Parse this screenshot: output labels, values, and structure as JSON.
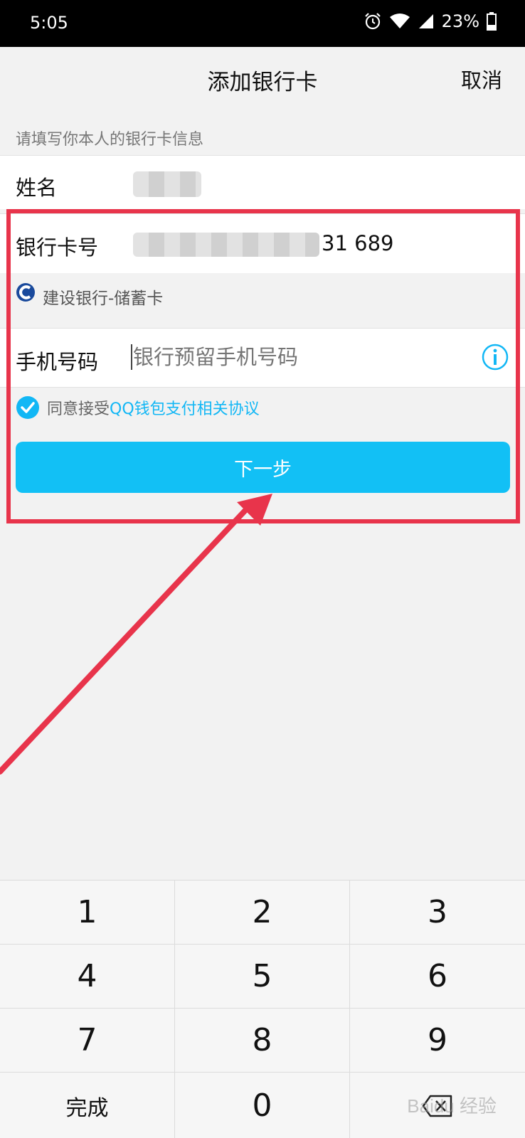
{
  "status": {
    "time": "5:05",
    "battery": "23%"
  },
  "nav": {
    "title": "添加银行卡",
    "cancel": "取消"
  },
  "hint": "请填写你本人的银行卡信息",
  "form": {
    "name_label": "姓名",
    "card_label": "银行卡号",
    "card_visible_suffix": "31 689",
    "bank_name": "建设银行-储蓄卡",
    "phone_label": "手机号码",
    "phone_placeholder": "银行预留手机号码"
  },
  "agreement": {
    "prefix": "同意接受",
    "link": "QQ钱包支付相关协议",
    "checked": true
  },
  "next_button": "下一步",
  "keypad": {
    "keys": [
      "1",
      "2",
      "3",
      "4",
      "5",
      "6",
      "7",
      "8",
      "9",
      "完成",
      "0"
    ],
    "backspace_icon": "backspace-icon"
  },
  "watermark": "Baidu 经验",
  "colors": {
    "accent": "#12c0f5",
    "annotation": "#e8344b",
    "bank_logo": "#1a4a9c"
  }
}
